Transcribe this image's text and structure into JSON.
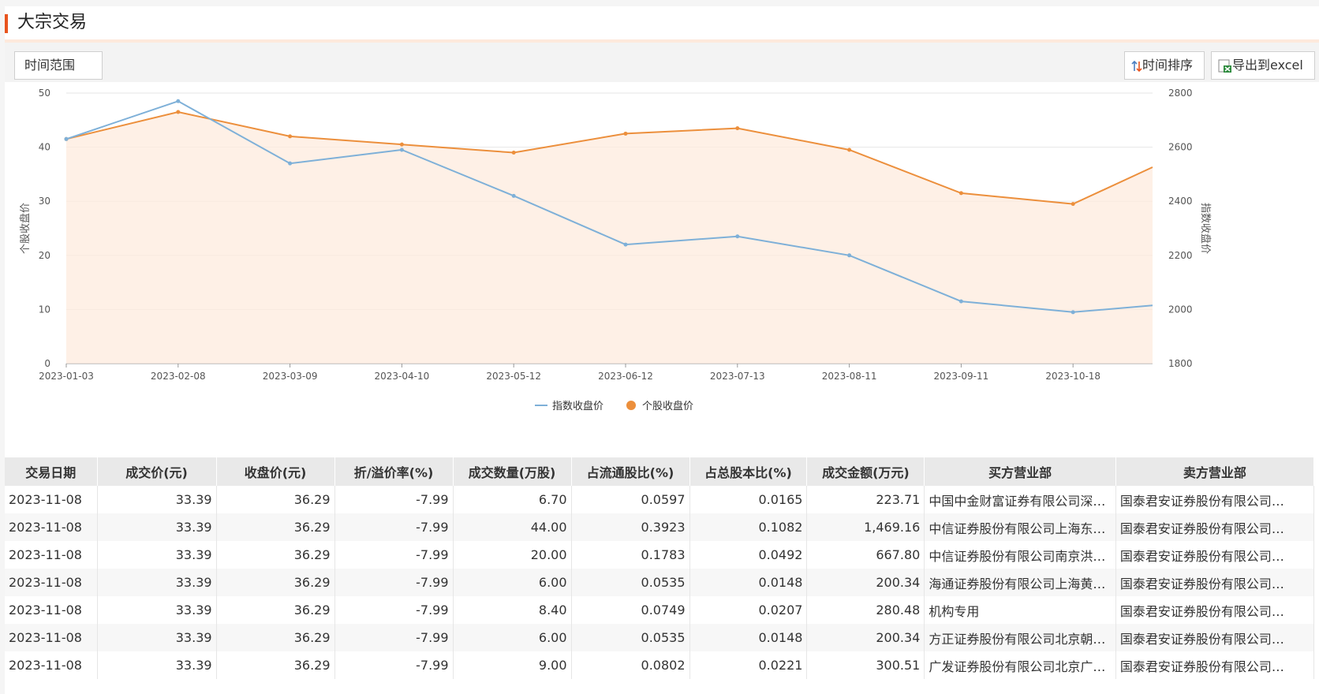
{
  "page": {
    "title": "大宗交易"
  },
  "toolbar": {
    "range_label": "时间范围",
    "sort_label": "时间排序",
    "export_label": "导出到excel"
  },
  "colors": {
    "accent": "#e8541e",
    "index_line": "#7eb0d8",
    "stock_line": "#ec8f3c",
    "area_fill": "#fdebdd"
  },
  "icons": {
    "sort": "sort-arrows-icon",
    "export": "excel-export-icon"
  },
  "chart_data": {
    "type": "line",
    "x": [
      "2023-01-03",
      "2023-02-08",
      "2023-03-09",
      "2023-04-10",
      "2023-05-12",
      "2023-06-12",
      "2023-07-13",
      "2023-08-11",
      "2023-09-11",
      "2023-10-18"
    ],
    "x_ticks": [
      "2023-01-03",
      "2023-02-08",
      "2023-03-09",
      "2023-04-10",
      "2023-05-12",
      "2023-06-12",
      "2023-07-13",
      "2023-08-11",
      "2023-09-11",
      "2023-10-18"
    ],
    "ylabel_left": "个股收盘价",
    "ylabel_right": "指数收盘价",
    "ylim_left": [
      0,
      50
    ],
    "yticks_left": [
      0,
      10,
      20,
      30,
      40,
      50
    ],
    "ylim_right": [
      1800,
      2800
    ],
    "yticks_right": [
      1800,
      2000,
      2200,
      2400,
      2600,
      2800
    ],
    "grid": true,
    "legend_position": "bottom",
    "series": [
      {
        "name": "指数收盘价",
        "axis": "right",
        "values": [
          2630,
          2770,
          2540,
          2590,
          2420,
          2240,
          2270,
          2200,
          2030,
          1990
        ]
      },
      {
        "name": "个股收盘价",
        "axis": "left",
        "values": [
          41.5,
          46.5,
          42.0,
          40.5,
          39.0,
          42.5,
          43.5,
          39.5,
          31.5,
          29.5
        ]
      }
    ]
  },
  "table": {
    "headers": [
      "交易日期",
      "成交价(元)",
      "收盘价(元)",
      "折/溢价率(%)",
      "成交数量(万股)",
      "占流通股比(%)",
      "占总股本比(%)",
      "成交金额(万元)",
      "买方营业部",
      "卖方营业部"
    ],
    "rows": [
      [
        "2023-11-08",
        "33.39",
        "36.29",
        "-7.99",
        "6.70",
        "0.0597",
        "0.0165",
        "223.71",
        "中国中金财富证券有限公司深…",
        "国泰君安证券股份有限公司…"
      ],
      [
        "2023-11-08",
        "33.39",
        "36.29",
        "-7.99",
        "44.00",
        "0.3923",
        "0.1082",
        "1,469.16",
        "中信证券股份有限公司上海东…",
        "国泰君安证券股份有限公司…"
      ],
      [
        "2023-11-08",
        "33.39",
        "36.29",
        "-7.99",
        "20.00",
        "0.1783",
        "0.0492",
        "667.80",
        "中信证券股份有限公司南京洪…",
        "国泰君安证券股份有限公司…"
      ],
      [
        "2023-11-08",
        "33.39",
        "36.29",
        "-7.99",
        "6.00",
        "0.0535",
        "0.0148",
        "200.34",
        "海通证券股份有限公司上海黄…",
        "国泰君安证券股份有限公司…"
      ],
      [
        "2023-11-08",
        "33.39",
        "36.29",
        "-7.99",
        "8.40",
        "0.0749",
        "0.0207",
        "280.48",
        "机构专用",
        "国泰君安证券股份有限公司…"
      ],
      [
        "2023-11-08",
        "33.39",
        "36.29",
        "-7.99",
        "6.00",
        "0.0535",
        "0.0148",
        "200.34",
        "方正证券股份有限公司北京朝…",
        "国泰君安证券股份有限公司…"
      ],
      [
        "2023-11-08",
        "33.39",
        "36.29",
        "-7.99",
        "9.00",
        "0.0802",
        "0.0221",
        "300.51",
        "广发证券股份有限公司北京广…",
        "国泰君安证券股份有限公司…"
      ]
    ]
  }
}
